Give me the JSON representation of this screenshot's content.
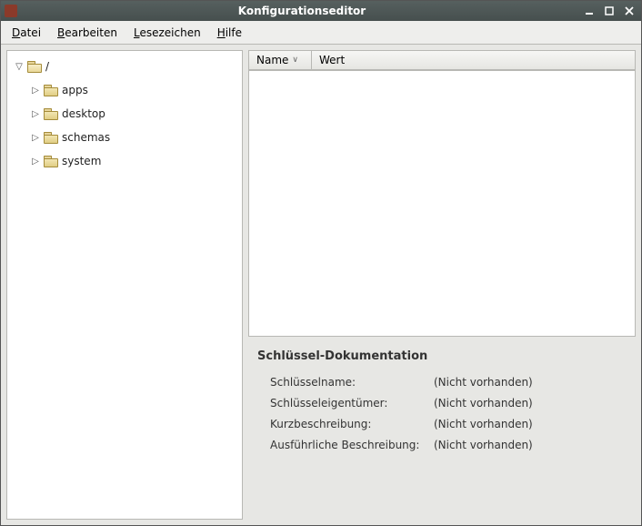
{
  "window": {
    "title": "Konfigurationseditor"
  },
  "menubar": {
    "file": "Datei",
    "edit": "Bearbeiten",
    "bookmarks": "Lesezeichen",
    "help": "Hilfe"
  },
  "tree": {
    "root": "/",
    "items": [
      {
        "label": "apps"
      },
      {
        "label": "desktop"
      },
      {
        "label": "schemas"
      },
      {
        "label": "system"
      }
    ]
  },
  "table": {
    "col_name": "Name",
    "col_value": "Wert"
  },
  "doc": {
    "heading": "Schlüssel-Dokumentation",
    "key_name_label": "Schlüsselname:",
    "key_name_value": "(Nicht vorhanden)",
    "owner_label": "Schlüsseleigentümer:",
    "owner_value": "(Nicht vorhanden)",
    "short_label": "Kurzbeschreibung:",
    "short_value": "(Nicht vorhanden)",
    "long_label": "Ausführliche Beschreibung:",
    "long_value": "(Nicht vorhanden)"
  }
}
